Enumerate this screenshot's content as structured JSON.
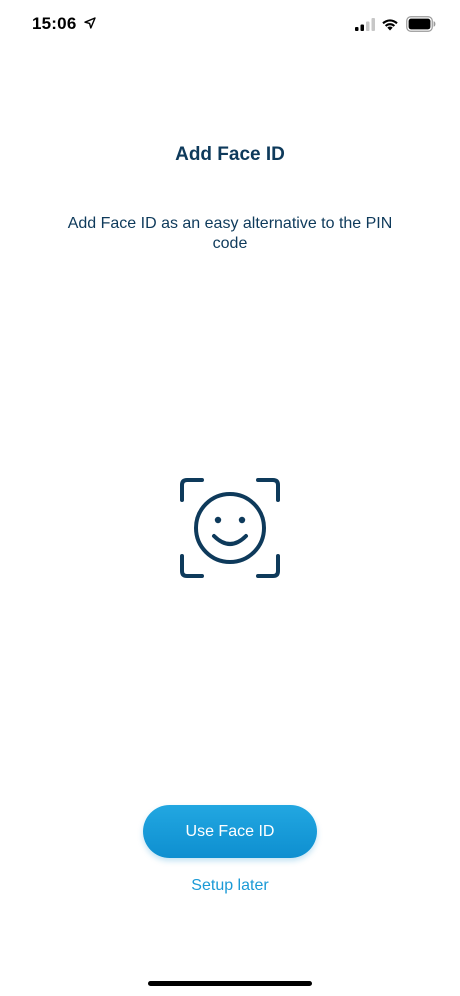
{
  "status_bar": {
    "time": "15:06",
    "icons": [
      "location-arrow-icon",
      "cellular-signal-icon",
      "wifi-icon",
      "battery-icon"
    ]
  },
  "main": {
    "title": "Add Face ID",
    "subtitle": "Add Face ID as an easy alternative to the PIN code",
    "illustration": "face-id-icon"
  },
  "actions": {
    "primary_label": "Use Face ID",
    "secondary_label": "Setup later"
  },
  "colors": {
    "text_primary": "#0e3a5b",
    "accent": "#1b9ad6",
    "button_gradient_top": "#22a7e1",
    "button_gradient_bottom": "#0e8fd0"
  }
}
